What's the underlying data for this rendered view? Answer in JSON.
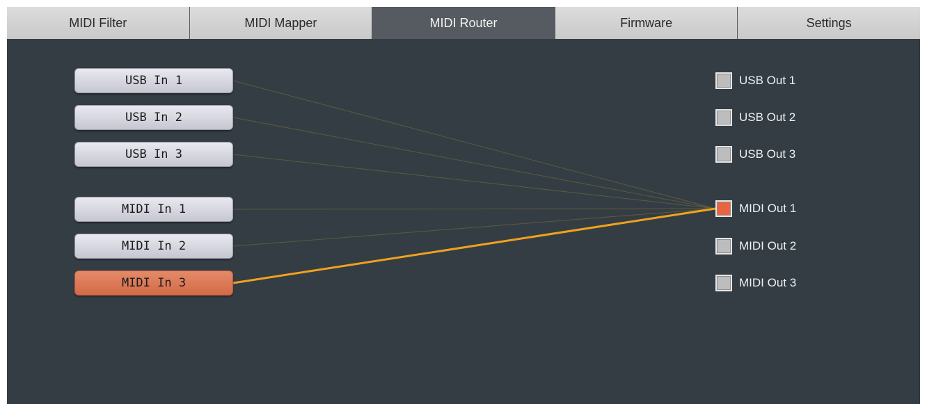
{
  "tabs": [
    {
      "label": "MIDI Filter",
      "active": false
    },
    {
      "label": "MIDI Mapper",
      "active": false
    },
    {
      "label": "MIDI Router",
      "active": true
    },
    {
      "label": "Firmware",
      "active": false
    },
    {
      "label": "Settings",
      "active": false
    }
  ],
  "router": {
    "inputs": [
      {
        "label": "USB In 1",
        "active": false
      },
      {
        "label": "USB In 2",
        "active": false
      },
      {
        "label": "USB In 3",
        "active": false
      },
      {
        "label": "MIDI In 1",
        "active": false
      },
      {
        "label": "MIDI In 2",
        "active": false
      },
      {
        "label": "MIDI In 3",
        "active": true
      }
    ],
    "outputs": [
      {
        "label": "USB Out 1",
        "active": false
      },
      {
        "label": "USB Out 2",
        "active": false
      },
      {
        "label": "USB Out 3",
        "active": false
      },
      {
        "label": "MIDI Out 1",
        "active": true
      },
      {
        "label": "MIDI Out 2",
        "active": false
      },
      {
        "label": "MIDI Out 3",
        "active": false
      }
    ],
    "selected_output": "MIDI Out 1",
    "routes_to_selected": [
      "USB In 1",
      "USB In 2",
      "USB In 3",
      "MIDI In 1",
      "MIDI In 2",
      "MIDI In 3"
    ],
    "active_route": {
      "from": "MIDI In 3",
      "to": "MIDI Out 1"
    }
  },
  "colors": {
    "background": "#343d44",
    "active_tab": "#555b60",
    "active_wire": "#f0a21c",
    "inactive_wire": "#5d5a3e",
    "active_input": "#d97452",
    "active_output": "#ea6440"
  }
}
